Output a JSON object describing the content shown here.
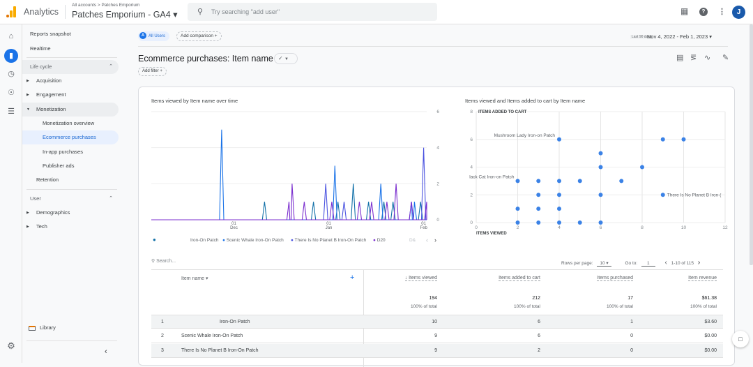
{
  "topbar": {
    "app_name": "Analytics",
    "breadcrumb": "All accounts > Patches Emporium",
    "property": "Patches Emporium - GA4 ▾",
    "search_placeholder": "Try searching \"add user\"",
    "avatar_initial": "J",
    "icons": [
      "apps-grid-icon",
      "help-icon",
      "more-vert-icon"
    ]
  },
  "rail": {
    "icons": [
      "home-icon",
      "reports-icon",
      "explore-icon",
      "advertising-icon",
      "configure-icon",
      "settings-icon"
    ]
  },
  "nav": {
    "reports_snapshot": "Reports snapshot",
    "realtime": "Realtime",
    "lifecycle": "Life cycle",
    "acquisition": "Acquisition",
    "engagement": "Engagement",
    "monetization": "Monetization",
    "monetization_overview": "Monetization overview",
    "ecommerce_purchases": "Ecommerce purchases",
    "inapp_purchases": "In-app purchases",
    "publisher_ads": "Publisher ads",
    "retention": "Retention",
    "user": "User",
    "demographics": "Demographics",
    "tech": "Tech",
    "library": "Library"
  },
  "header": {
    "segment_badge": "A",
    "segment_label": "All Users",
    "add_comparison": "Add comparison  +",
    "date_range_label": "Last 90 days",
    "date_range": "Nov 4, 2022 - Feb 1, 2023 ▾",
    "page_title": "Ecommerce purchases: Item name",
    "add_filter": "Add filter  +"
  },
  "chart_data": [
    {
      "type": "line",
      "title": "Items viewed by Item name over time",
      "x_ticks": [
        {
          "day": "01",
          "month": "Dec"
        },
        {
          "day": "01",
          "month": "Jan"
        },
        {
          "day": "01",
          "month": "Feb"
        }
      ],
      "y_ticks": [
        "0",
        "2",
        "4",
        "6"
      ],
      "ylim": [
        0,
        6
      ],
      "x_range_days": 90,
      "legend": [
        "Iron-On Patch",
        "Scenic Whale Iron-On Patch",
        "There Is No Planet B Iron-On Patch",
        "D20",
        "D&"
      ],
      "legend_colors": [
        "#1170a8",
        "#1a73e8",
        "#4a52e0",
        "#7b2fcf"
      ],
      "series": [
        {
          "name": "Iron-On Patch",
          "color": "#1170a8",
          "peaks": [
            [
              37,
              1
            ],
            [
              53,
              1
            ],
            [
              61,
              1
            ],
            [
              66,
              2
            ],
            [
              71,
              1
            ],
            [
              76,
              1
            ],
            [
              79,
              1
            ],
            [
              88,
              1
            ]
          ]
        },
        {
          "name": "Scenic Whale Iron-On Patch",
          "color": "#1a73e8",
          "peaks": [
            [
              23,
              5
            ],
            [
              60,
              3
            ],
            [
              75,
              2
            ],
            [
              85,
              1
            ],
            [
              86,
              1
            ]
          ]
        },
        {
          "name": "There Is No Planet B Iron-On Patch",
          "color": "#4a52e0",
          "peaks": [
            [
              57,
              2
            ],
            [
              63,
              1
            ],
            [
              89,
              4
            ]
          ]
        },
        {
          "name": "D20",
          "color": "#7b2fcf",
          "peaks": [
            [
              45,
              1
            ],
            [
              46,
              2
            ],
            [
              50,
              1
            ],
            [
              59,
              1
            ],
            [
              68,
              1
            ],
            [
              72,
              1
            ],
            [
              77,
              1
            ],
            [
              80,
              2
            ],
            [
              85,
              1
            ],
            [
              90,
              1
            ]
          ]
        }
      ]
    },
    {
      "type": "scatter",
      "title": "Items viewed and Items added to cart by Item name",
      "xlabel": "ITEMS VIEWED",
      "ylabel": "ITEMS ADDED TO CART",
      "xlim": [
        0,
        12
      ],
      "ylim": [
        0,
        8
      ],
      "x_ticks": [
        "0",
        "2",
        "4",
        "6",
        "8",
        "10",
        "12"
      ],
      "y_ticks": [
        "0",
        "2",
        "4",
        "6",
        "8"
      ],
      "points": [
        [
          2,
          0
        ],
        [
          3,
          0
        ],
        [
          4,
          0
        ],
        [
          5,
          0
        ],
        [
          6,
          0
        ],
        [
          2,
          1
        ],
        [
          3,
          1
        ],
        [
          4,
          1
        ],
        [
          3,
          2
        ],
        [
          4,
          2
        ],
        [
          6,
          2
        ],
        [
          9,
          2
        ],
        [
          2,
          3
        ],
        [
          3,
          3
        ],
        [
          4,
          3
        ],
        [
          5,
          3
        ],
        [
          7,
          3
        ],
        [
          6,
          4
        ],
        [
          8,
          4
        ],
        [
          6,
          5
        ],
        [
          4,
          6
        ],
        [
          9,
          6
        ],
        [
          10,
          6
        ]
      ],
      "annotations": [
        {
          "label": "Mushroom Lady Iron-on Patch",
          "x": 4,
          "y": 6
        },
        {
          "label": "lack Cat Iron-on Patch",
          "x": 2,
          "y": 3
        },
        {
          "label": "There Is No Planet B Iron-(",
          "x": 9,
          "y": 2
        }
      ]
    }
  ],
  "table": {
    "search_placeholder": "Search...",
    "rows_per_page_label": "Rows per page:",
    "rows_per_page": "10",
    "goto_label": "Go to:",
    "goto_value": "1",
    "pagination": "1-10 of 115",
    "dimension_header": "Item name ▾",
    "columns": [
      "↓ Items viewed",
      "Items added to cart",
      "Items purchased",
      "Item revenue"
    ],
    "totals": [
      "194",
      "212",
      "17",
      "$61.38"
    ],
    "totals_sub": [
      "100% of total",
      "100% of total",
      "100% of total",
      "100% of total"
    ],
    "rows": [
      {
        "idx": "1",
        "name": "Iron-On Patch",
        "viewed": "10",
        "cart": "6",
        "purchased": "1",
        "revenue": "$3.60"
      },
      {
        "idx": "2",
        "name": "Scenic Whale Iron-On Patch",
        "viewed": "9",
        "cart": "6",
        "purchased": "0",
        "revenue": "$0.00"
      },
      {
        "idx": "3",
        "name": "There Is No Planet B Iron-On Patch",
        "viewed": "9",
        "cart": "2",
        "purchased": "0",
        "revenue": "$0.00"
      }
    ]
  }
}
